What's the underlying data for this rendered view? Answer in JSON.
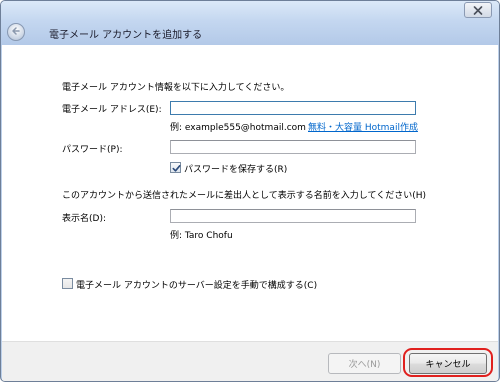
{
  "window": {
    "title": "電子メール アカウントを追加する"
  },
  "icons": {
    "close": "close-icon",
    "back": "back-arrow-icon",
    "checkmark": "checkmark-icon"
  },
  "colors": {
    "link": "#0066cc",
    "highlight": "#e0201e"
  },
  "form": {
    "instructions": "電子メール アカウント情報を以下に入力してください。",
    "email_label": "電子メール アドレス(E):",
    "email_value": "",
    "email_example": "例: example555@hotmail.com",
    "hotmail_link": "無料・大容量 Hotmail作成",
    "password_label": "パスワード(P):",
    "password_value": "",
    "save_password_label": "パスワードを保存する(R)",
    "save_password_checked": true,
    "display_name_instructions": "このアカウントから送信されたメールに差出人として表示する名前を入力してください(H)",
    "display_name_label": "表示名(D):",
    "display_name_value": "",
    "display_name_example": "例: Taro Chofu",
    "manual_config_label": "電子メール アカウントのサーバー設定を手動で構成する(C)",
    "manual_config_checked": false
  },
  "footer": {
    "next_label": "次へ(N)",
    "cancel_label": "キャンセル"
  }
}
